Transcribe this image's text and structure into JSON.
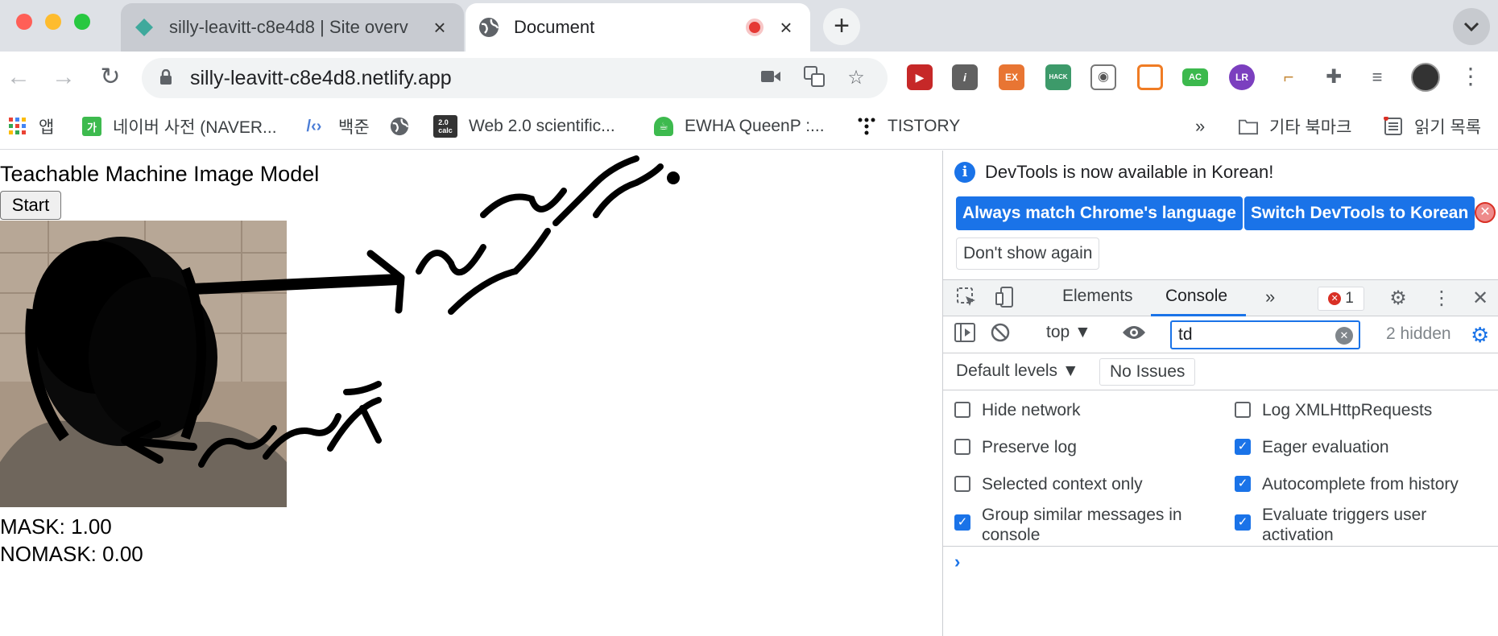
{
  "browser": {
    "tabs": [
      {
        "title": "silly-leavitt-c8e4d8 | Site overv",
        "close": "×"
      },
      {
        "title": "Document",
        "close": "×"
      }
    ],
    "new_tab": "+",
    "url": "silly-leavitt-c8e4d8.netlify.app",
    "bookmarks": [
      {
        "label": "앱"
      },
      {
        "label": "네이버 사전 (NAVER..."
      },
      {
        "label": "백준"
      },
      {
        "label": ""
      },
      {
        "label": "Web 2.0 scientific..."
      },
      {
        "label": "EWHA QueenP :..."
      },
      {
        "label": "TISTORY"
      }
    ],
    "bookmarks_more": "»",
    "other_bookmarks": "기타 북마크",
    "reading_list": "읽기 목록"
  },
  "page": {
    "title": "Teachable Machine Image Model",
    "start_button": "Start",
    "labels": [
      "MASK: 1.00",
      "NOMASK: 0.00"
    ]
  },
  "devtools": {
    "info": "DevTools is now available in Korean!",
    "buttons": {
      "match_language": "Always match Chrome's language",
      "switch_korean": "Switch DevTools to Korean",
      "dont_show": "Don't show again"
    },
    "tabs": {
      "elements": "Elements",
      "console": "Console",
      "more": "»"
    },
    "error_count": "1",
    "context": "top ▼",
    "filter_value": "td",
    "hidden": "2 hidden",
    "levels": "Default levels ▼",
    "issues": "No Issues",
    "settings": [
      {
        "label": "Hide network",
        "checked": false
      },
      {
        "label": "Log XMLHttpRequests",
        "checked": false
      },
      {
        "label": "Preserve log",
        "checked": false
      },
      {
        "label": "Eager evaluation",
        "checked": true
      },
      {
        "label": "Selected context only",
        "checked": false
      },
      {
        "label": "Autocomplete from history",
        "checked": true
      },
      {
        "label": "Group similar messages in console",
        "checked": true
      },
      {
        "label": "Evaluate triggers user activation",
        "checked": true
      }
    ],
    "prompt": "›"
  },
  "colors": {
    "accent": "#1a73e8",
    "error": "#d93025",
    "tabstrip": "#dee1e6"
  }
}
